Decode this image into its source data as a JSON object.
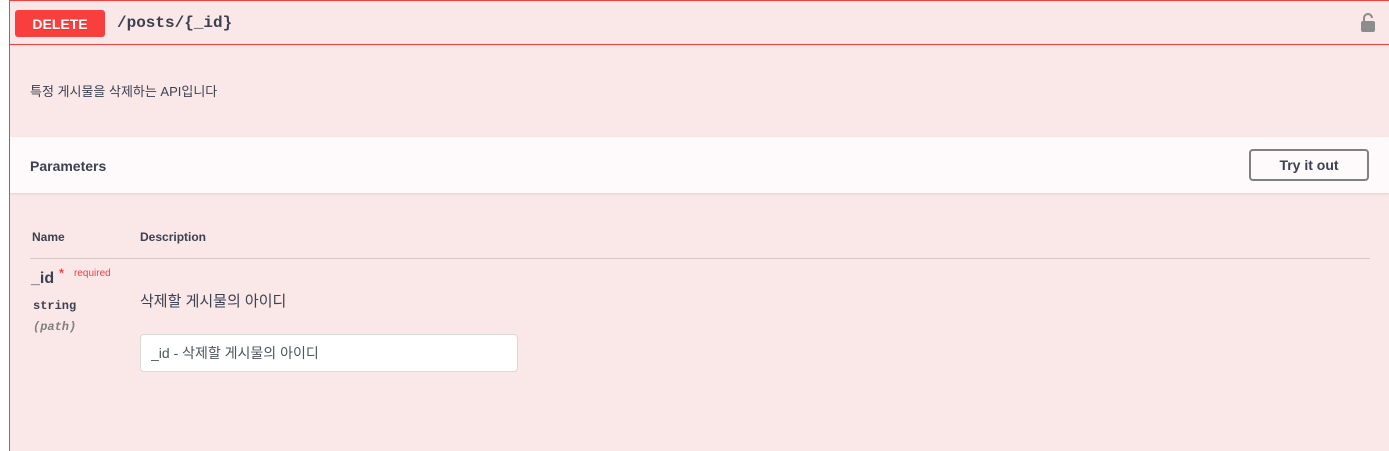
{
  "operation": {
    "method": "DELETE",
    "path": "/posts/{_id}",
    "description": "특정 게시물을 삭제하는 API입니다",
    "lock_icon": "lock-icon"
  },
  "parameters": {
    "title": "Parameters",
    "try_button": "Try it out",
    "columns": {
      "name": "Name",
      "description": "Description"
    },
    "items": [
      {
        "name": "_id",
        "required_star": "*",
        "required_label": "required",
        "type": "string",
        "in": "(path)",
        "description": "삭제할 게시물의 아이디",
        "placeholder": "_id - 삭제할 게시물의 아이디"
      }
    ]
  },
  "colors": {
    "delete_accent": "#f93e3e",
    "block_background": "#fae7e8"
  }
}
